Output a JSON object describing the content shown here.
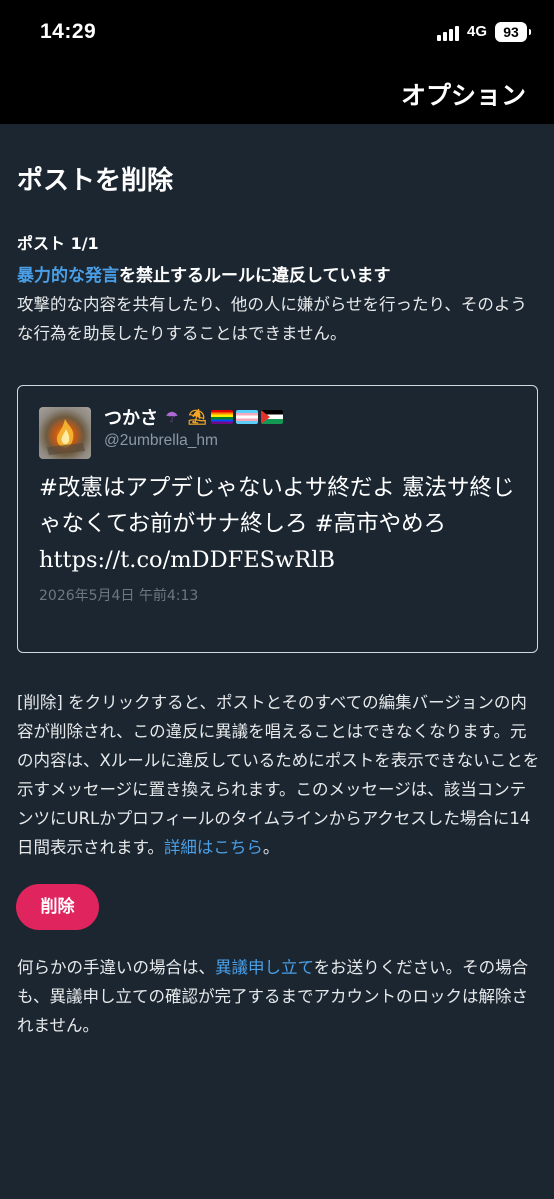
{
  "status_bar": {
    "time": "14:29",
    "network": "4G",
    "battery": "93"
  },
  "header": {
    "title": "オプション"
  },
  "page": {
    "title": "ポストを削除",
    "post_count": "ポスト 1/1",
    "rule_link": "暴力的な発言",
    "rule_rest": "を禁止するルールに違反しています",
    "rule_description": "攻撃的な内容を共有したり、他の人に嫌がらせを行ったり、そのような行為を助長したりすることはできません。"
  },
  "post": {
    "display_name": "つかさ",
    "emojis": [
      "☂",
      "⛱"
    ],
    "flags": [
      "rainbow",
      "trans",
      "palestine"
    ],
    "handle": "@2umbrella_hm",
    "text": "#改憲はアプデじゃないよサ終だよ 憲法サ終じゃなくてお前がサナ終しろ #高市やめろ https://t.co/mDDFESwRlB",
    "timestamp": "2026年5月4日 午前4:13"
  },
  "explanation": {
    "text": "[削除] をクリックすると、ポストとそのすべての編集バージョンの内容が削除され、この違反に異議を唱えることはできなくなります。元の内容は、Xルールに違反しているためにポストを表示できないことを示すメッセージに置き換えられます。このメッセージは、該当コンテンツにURLかプロフィールのタイムラインからアクセスした場合に14日間表示されます。",
    "link": "詳細はこちら",
    "suffix": "。"
  },
  "delete_button": {
    "label": "削除"
  },
  "appeal": {
    "prefix": "何らかの手違いの場合は、",
    "link": "異議申し立て",
    "suffix": "をお送りください。その場合も、異議申し立ての確認が完了するまでアカウントのロックは解除されません。"
  },
  "colors": {
    "background": "#1b2631",
    "link": "#4a9fe6",
    "delete": "#e0245e"
  }
}
